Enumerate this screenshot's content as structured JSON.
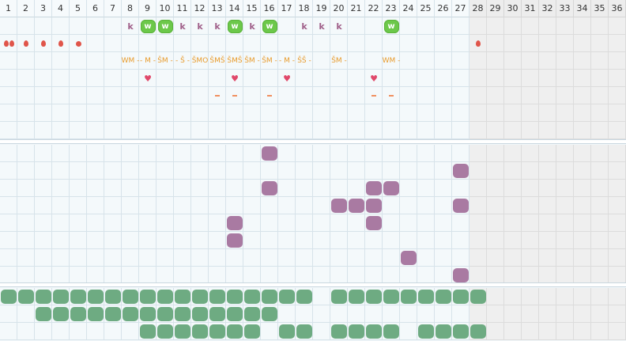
{
  "columns": [
    "1",
    "2",
    "3",
    "4",
    "5",
    "6",
    "7",
    "8",
    "9",
    "10",
    "11",
    "12",
    "13",
    "14",
    "15",
    "16",
    "17",
    "18",
    "19",
    "20",
    "21",
    "22",
    "23",
    "24",
    "25",
    "26",
    "27",
    "28",
    "29",
    "30",
    "31",
    "32",
    "33",
    "34",
    "35",
    "36"
  ],
  "active_columns": 27,
  "colors": {
    "purple_swatch": "#a97aa2",
    "green_swatch": "#6eab82",
    "w_badge": "#6cc84a",
    "k_letter": "#a0608a",
    "drop": "#e0554a",
    "heart": "#e0486a",
    "label": "#e89a2a",
    "dash": "#f09060"
  },
  "top": {
    "k_row": {
      "k": [
        8,
        11,
        12,
        13,
        15,
        18,
        19,
        20
      ],
      "w": [
        9,
        10,
        14,
        16,
        23
      ],
      "k_text": "k",
      "w_text": "w"
    },
    "drop_row": {
      "double_drop": [
        1
      ],
      "drop": [
        2,
        3,
        4,
        28
      ],
      "dot": [
        5
      ]
    },
    "label_row": {
      "labels": [
        {
          "col": 8,
          "text": "WM -"
        },
        {
          "col": 9,
          "text": "- M -"
        },
        {
          "col": 10,
          "text": "ŠM -"
        },
        {
          "col": 11,
          "text": "- Š -"
        },
        {
          "col": 12,
          "text": "ŠMO"
        },
        {
          "col": 13,
          "text": "ŠMŠ"
        },
        {
          "col": 14,
          "text": "ŠMŠ"
        },
        {
          "col": 15,
          "text": "ŠM -"
        },
        {
          "col": 16,
          "text": "ŠM -"
        },
        {
          "col": 17,
          "text": "- M -"
        },
        {
          "col": 18,
          "text": "ŠŠ -"
        },
        {
          "col": 20,
          "text": "ŠM -"
        },
        {
          "col": 23,
          "text": "WM -"
        }
      ]
    },
    "heart_row": {
      "hearts": [
        9,
        14,
        17,
        22
      ]
    },
    "dash_row": {
      "dashes": [
        13,
        14,
        16,
        22,
        23
      ]
    }
  },
  "middle": {
    "swatches": [
      {
        "row": 1,
        "col": 16
      },
      {
        "row": 2,
        "col": 27
      },
      {
        "row": 3,
        "col": 16
      },
      {
        "row": 3,
        "col": 22
      },
      {
        "row": 3,
        "col": 23
      },
      {
        "row": 4,
        "col": 20
      },
      {
        "row": 4,
        "col": 21
      },
      {
        "row": 4,
        "col": 22
      },
      {
        "row": 4,
        "col": 27
      },
      {
        "row": 5,
        "col": 14
      },
      {
        "row": 5,
        "col": 22
      },
      {
        "row": 6,
        "col": 14
      },
      {
        "row": 7,
        "col": 24
      },
      {
        "row": 8,
        "col": 27
      }
    ]
  },
  "bottom": {
    "rows": [
      [
        1,
        2,
        3,
        4,
        5,
        6,
        7,
        8,
        9,
        10,
        11,
        12,
        13,
        14,
        15,
        16,
        17,
        18,
        20,
        21,
        22,
        23,
        24,
        25,
        26,
        27,
        28
      ],
      [
        3,
        4,
        5,
        6,
        7,
        8,
        9,
        10,
        11,
        12,
        13,
        14,
        15,
        16
      ],
      [
        9,
        10,
        11,
        12,
        13,
        14,
        15,
        17,
        18,
        20,
        21,
        22,
        23,
        25,
        26,
        27,
        28
      ]
    ]
  }
}
